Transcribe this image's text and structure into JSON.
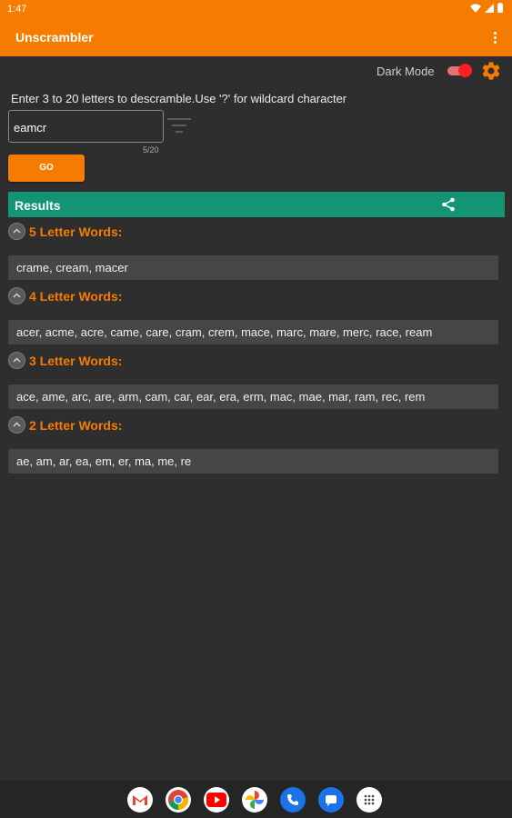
{
  "status_bar": {
    "time": "1:47"
  },
  "app_bar": {
    "title": "Unscrambler"
  },
  "dark_mode": {
    "label": "Dark Mode",
    "enabled": true
  },
  "instruction": "Enter 3 to 20 letters to descramble.Use '?' for wildcard character",
  "input": {
    "value": "eamcr",
    "counter": "5/20"
  },
  "go_label": "GO",
  "results": {
    "label": "Results",
    "sections": [
      {
        "heading": "5 Letter Words:",
        "words": "crame, cream, macer"
      },
      {
        "heading": "4 Letter Words:",
        "words": "acer, acme, acre, came, care, cram, crem, mace, marc, mare, merc, race, ream"
      },
      {
        "heading": "3 Letter Words:",
        "words": "ace, ame, arc, are, arm, cam, car, ear, era, erm, mac, mae, mar, ram, rec, rem"
      },
      {
        "heading": "2 Letter Words:",
        "words": "ae, am, ar, ea, em, er, ma, me, re"
      }
    ]
  },
  "colors": {
    "accent": "#f57c00",
    "results_bar": "#139474",
    "background": "#2e2e2e"
  },
  "dock_apps": [
    "gmail-icon",
    "chrome-icon",
    "youtube-icon",
    "photos-icon",
    "phone-icon",
    "messages-icon",
    "app-drawer-icon"
  ]
}
